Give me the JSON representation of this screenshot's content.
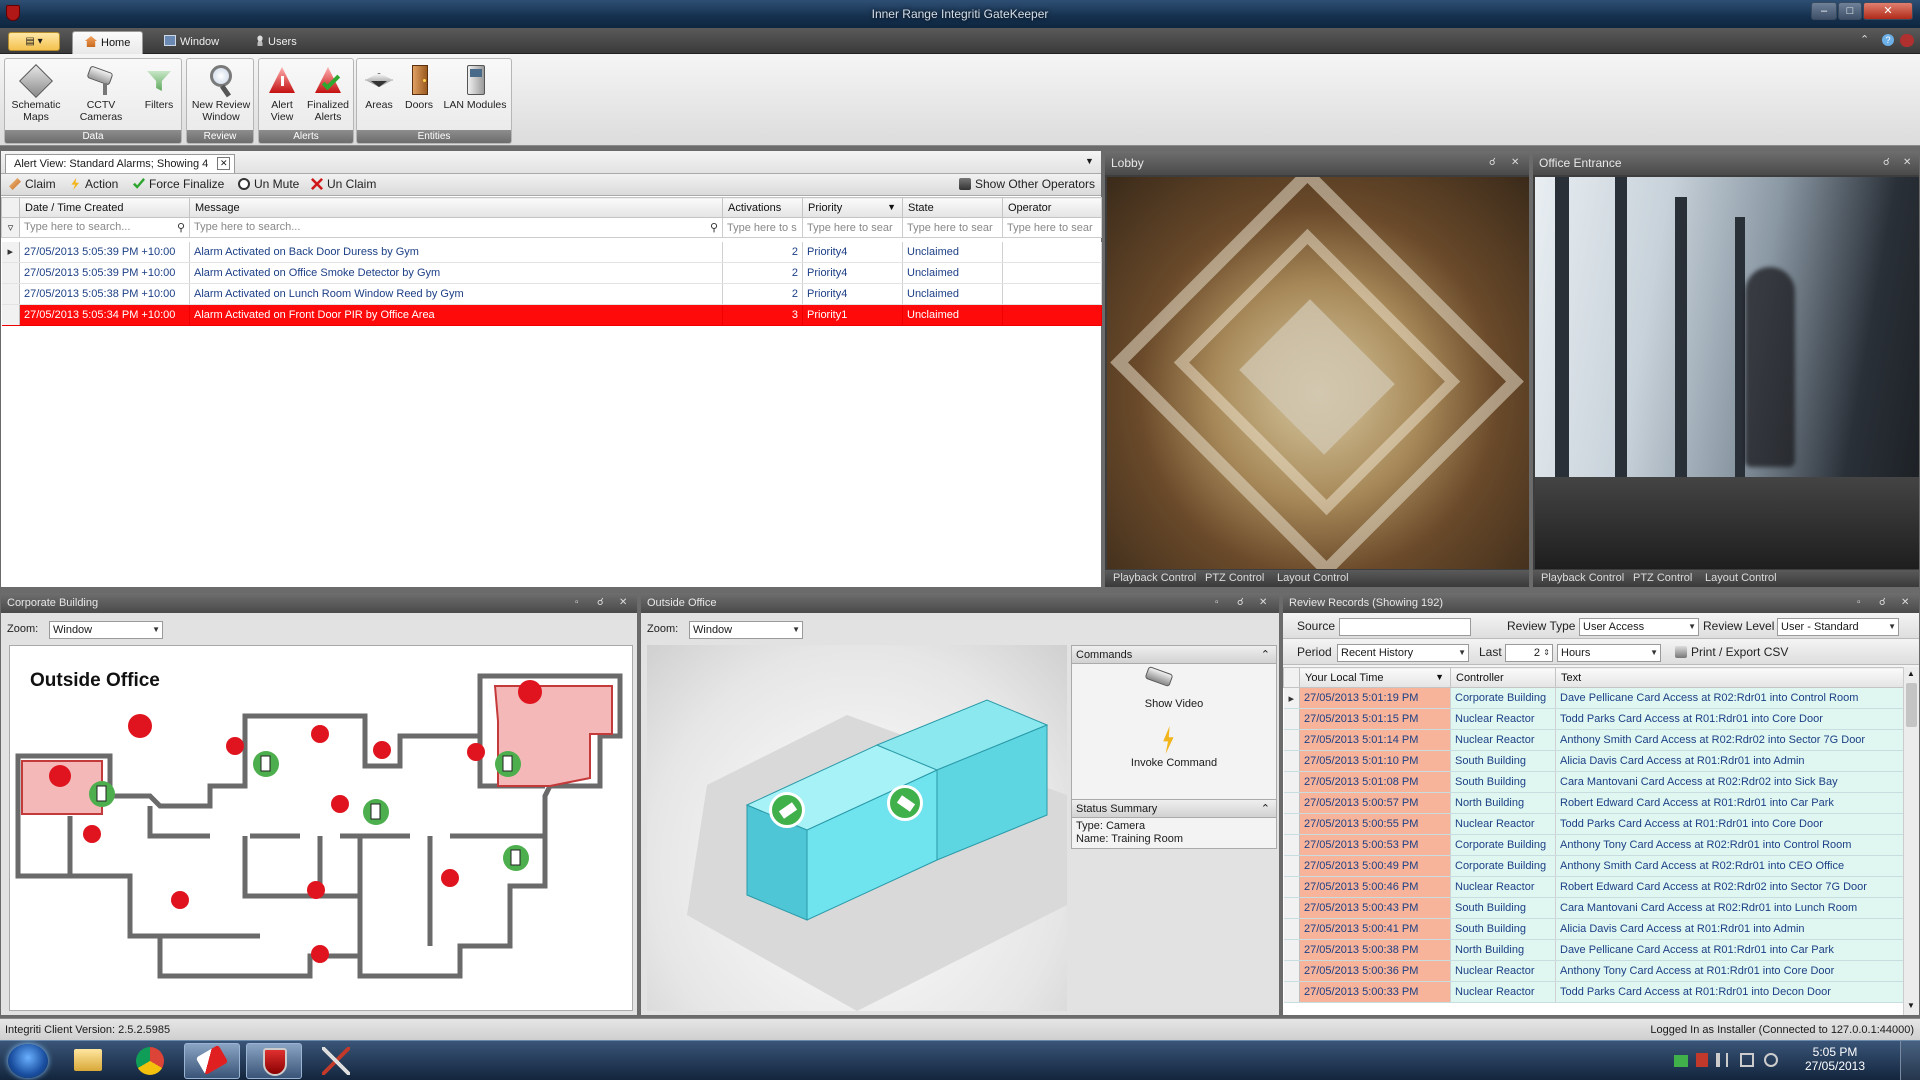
{
  "window": {
    "title": "Inner Range Integriti GateKeeper"
  },
  "tabs": [
    {
      "label": "Home"
    },
    {
      "label": "Window"
    },
    {
      "label": "Users"
    }
  ],
  "ribbon": {
    "groups": [
      {
        "label": "Data",
        "buttons": [
          "Schematic Maps",
          "CCTV Cameras",
          "Filters"
        ]
      },
      {
        "label": "Review",
        "buttons": [
          "New Review Window"
        ]
      },
      {
        "label": "Alerts",
        "buttons": [
          "Alert View",
          "Finalized Alerts"
        ]
      },
      {
        "label": "Entities",
        "buttons": [
          "Areas",
          "Doors",
          "LAN Modules"
        ]
      }
    ],
    "schematic_1": "Schematic",
    "schematic_2": "Maps",
    "review_1": "New Review",
    "review_2": "Window",
    "alert_1": "Alert",
    "alert_2": "View",
    "final_1": "Finalized",
    "final_2": "Alerts"
  },
  "alert_view": {
    "tab_title": "Alert View: Standard Alarms; Showing 4",
    "toolbar": {
      "claim": "Claim",
      "action": "Action",
      "force_finalize": "Force Finalize",
      "un_mute": "Un Mute",
      "un_claim": "Un Claim",
      "show_other": "Show Other Operators"
    },
    "columns": [
      "Date / Time Created",
      "Message",
      "Activations",
      "Priority",
      "State",
      "Operator"
    ],
    "filters": [
      "Type here to search...",
      "Type here to search...",
      "Type here to s",
      "Type here to sear",
      "Type here to sear",
      "Type here to sear"
    ],
    "rows": [
      {
        "date": "27/05/2013 5:05:39 PM +10:00",
        "message": "Alarm Activated on Back Door Duress by Gym",
        "activations": "2",
        "priority": "Priority4",
        "state": "Unclaimed",
        "operator": ""
      },
      {
        "date": "27/05/2013 5:05:39 PM +10:00",
        "message": "Alarm Activated on Office Smoke Detector by Gym",
        "activations": "2",
        "priority": "Priority4",
        "state": "Unclaimed",
        "operator": ""
      },
      {
        "date": "27/05/2013 5:05:38 PM +10:00",
        "message": "Alarm Activated on Lunch Room Window Reed by Gym",
        "activations": "2",
        "priority": "Priority4",
        "state": "Unclaimed",
        "operator": ""
      },
      {
        "date": "27/05/2013 5:05:34 PM +10:00",
        "message": "Alarm Activated on Front Door PIR by Office Area",
        "activations": "3",
        "priority": "Priority1",
        "state": "Unclaimed",
        "operator": ""
      }
    ]
  },
  "cameras": [
    {
      "title": "Lobby",
      "links": [
        "Playback Control",
        "PTZ Control",
        "Layout Control"
      ]
    },
    {
      "title": "Office Entrance",
      "links": [
        "Playback Control",
        "PTZ Control",
        "Layout Control"
      ]
    }
  ],
  "corporate": {
    "title": "Corporate Building",
    "zoom_label": "Zoom:",
    "zoom_value": "Window",
    "map_title": "Outside Office"
  },
  "outside": {
    "title": "Outside Office",
    "zoom_label": "Zoom:",
    "zoom_value": "Window",
    "commands_title": "Commands",
    "show_video": "Show Video",
    "invoke_command": "Invoke Command",
    "status_title": "Status Summary",
    "status_type": "Type: Camera",
    "status_name": "Name: Training Room"
  },
  "review": {
    "title": "Review Records (Showing 192)",
    "source_label": "Source",
    "review_type_label": "Review Type",
    "review_type": "User Access",
    "review_level_label": "Review Level",
    "review_level": "User - Standard",
    "period_label": "Period",
    "period": "Recent History",
    "last_label": "Last",
    "last_value": "2",
    "unit": "Hours",
    "export": "Print / Export CSV",
    "columns": [
      "Your Local Time",
      "Controller",
      "Text"
    ],
    "rows": [
      {
        "time": "27/05/2013 5:01:19 PM",
        "controller": "Corporate Building",
        "text": "Dave Pellicane Card Access at R02:Rdr01 into Control Room"
      },
      {
        "time": "27/05/2013 5:01:15 PM",
        "controller": "Nuclear Reactor",
        "text": "Todd Parks Card Access at R01:Rdr01 into Core Door"
      },
      {
        "time": "27/05/2013 5:01:14 PM",
        "controller": "Nuclear Reactor",
        "text": "Anthony Smith Card Access at R02:Rdr02 into Sector 7G Door"
      },
      {
        "time": "27/05/2013 5:01:10 PM",
        "controller": "South Building",
        "text": "Alicia Davis Card Access at R01:Rdr01 into Admin"
      },
      {
        "time": "27/05/2013 5:01:08 PM",
        "controller": "South Building",
        "text": "Cara Mantovani Card Access at R02:Rdr02 into Sick Bay"
      },
      {
        "time": "27/05/2013 5:00:57 PM",
        "controller": "North Building",
        "text": "Robert Edward Card Access at R01:Rdr01 into Car Park"
      },
      {
        "time": "27/05/2013 5:00:55 PM",
        "controller": "Nuclear Reactor",
        "text": "Todd Parks Card Access at R01:Rdr01 into Core Door"
      },
      {
        "time": "27/05/2013 5:00:53 PM",
        "controller": "Corporate Building",
        "text": "Anthony Tony Card Access at R02:Rdr01 into Control Room"
      },
      {
        "time": "27/05/2013 5:00:49 PM",
        "controller": "Corporate Building",
        "text": "Anthony Smith Card Access at R02:Rdr01 into CEO Office"
      },
      {
        "time": "27/05/2013 5:00:46 PM",
        "controller": "Nuclear Reactor",
        "text": "Robert Edward Card Access at R02:Rdr02 into Sector 7G Door"
      },
      {
        "time": "27/05/2013 5:00:43 PM",
        "controller": "South Building",
        "text": "Cara Mantovani Card Access at R02:Rdr01 into Lunch Room"
      },
      {
        "time": "27/05/2013 5:00:41 PM",
        "controller": "South Building",
        "text": "Alicia Davis Card Access at R01:Rdr01 into Admin"
      },
      {
        "time": "27/05/2013 5:00:38 PM",
        "controller": "North Building",
        "text": "Dave Pellicane Card Access at R01:Rdr01 into Car Park"
      },
      {
        "time": "27/05/2013 5:00:36 PM",
        "controller": "Nuclear Reactor",
        "text": "Anthony Tony Card Access at R01:Rdr01 into Core Door"
      },
      {
        "time": "27/05/2013 5:00:33 PM",
        "controller": "Nuclear Reactor",
        "text": "Todd Parks Card Access at R01:Rdr01 into Decon Door"
      }
    ]
  },
  "status": {
    "version": "Integriti Client Version: 2.5.2.5985",
    "login": "Logged In as Installer (Connected to 127.0.0.1:44000)"
  },
  "taskbar": {
    "time": "5:05 PM",
    "date": "27/05/2013"
  },
  "colors": {
    "alarm_red": "#ff0a0a",
    "time_cell": "#f7b49a",
    "row_mint": "#dff7f0",
    "cyan_building": "#6fe3ee",
    "marker_green": "#3fb04a"
  }
}
